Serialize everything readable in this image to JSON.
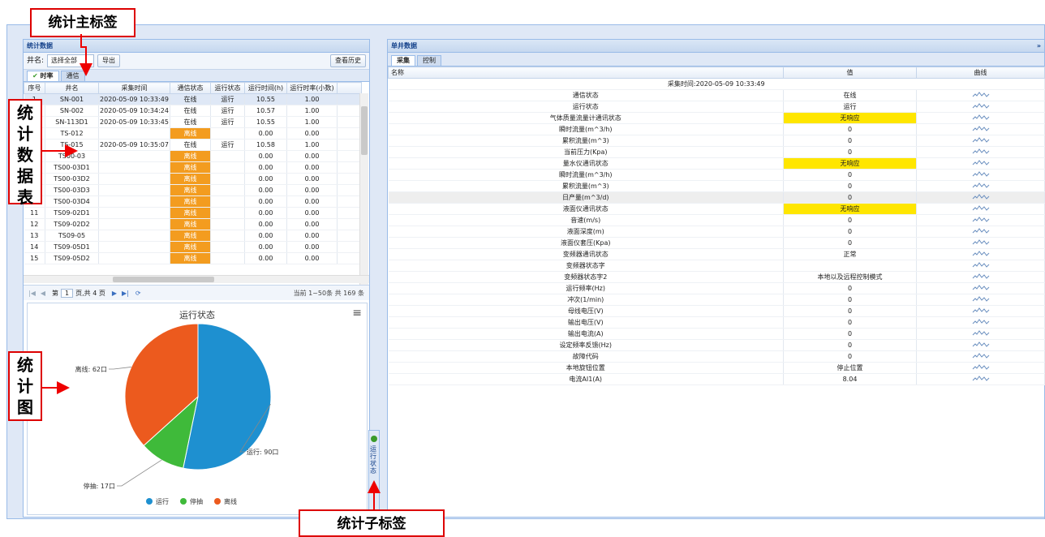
{
  "annotations": {
    "main_tab_label": "统计主标签",
    "table_label": "统计数据表",
    "chart_label": "统计图",
    "sub_tab_label": "统计子标签"
  },
  "left": {
    "panel_title": "统计数据",
    "well_label": "井名:",
    "well_select": "选择全部",
    "export_btn": "导出",
    "history_btn": "查看历史",
    "tabs": [
      "时率",
      "通信"
    ],
    "columns": [
      "序号",
      "井名",
      "采集时间",
      "通信状态",
      "运行状态",
      "运行时间(h)",
      "运行时率(小数)"
    ],
    "rows": [
      [
        "1",
        "SN-001",
        "2020-05-09 10:33:49",
        "在线",
        "运行",
        "10.55",
        "1.00"
      ],
      [
        "2",
        "SN-002",
        "2020-05-09 10:34:24",
        "在线",
        "运行",
        "10.57",
        "1.00"
      ],
      [
        "3",
        "SN-113D1",
        "2020-05-09 10:33:45",
        "在线",
        "运行",
        "10.55",
        "1.00"
      ],
      [
        "4",
        "TS-012",
        "",
        "离线",
        "",
        "0.00",
        "0.00"
      ],
      [
        "5",
        "TS-015",
        "2020-05-09 10:35:07",
        "在线",
        "运行",
        "10.58",
        "1.00"
      ],
      [
        "6",
        "TS00-03",
        "",
        "离线",
        "",
        "0.00",
        "0.00"
      ],
      [
        "7",
        "TS00-03D1",
        "",
        "离线",
        "",
        "0.00",
        "0.00"
      ],
      [
        "8",
        "TS00-03D2",
        "",
        "离线",
        "",
        "0.00",
        "0.00"
      ],
      [
        "9",
        "TS00-03D3",
        "",
        "离线",
        "",
        "0.00",
        "0.00"
      ],
      [
        "10",
        "TS00-03D4",
        "",
        "离线",
        "",
        "0.00",
        "0.00"
      ],
      [
        "11",
        "TS09-02D1",
        "",
        "离线",
        "",
        "0.00",
        "0.00"
      ],
      [
        "12",
        "TS09-02D2",
        "",
        "离线",
        "",
        "0.00",
        "0.00"
      ],
      [
        "13",
        "TS09-05",
        "",
        "离线",
        "",
        "0.00",
        "0.00"
      ],
      [
        "14",
        "TS09-05D1",
        "",
        "离线",
        "",
        "0.00",
        "0.00"
      ],
      [
        "15",
        "TS09-05D2",
        "",
        "离线",
        "",
        "0.00",
        "0.00"
      ]
    ],
    "pager": {
      "page_prefix": "第",
      "page": "1",
      "page_suffix": "页,共 4 页",
      "summary": "当前 1~50条 共 169 条"
    },
    "side_tab": "运行状态"
  },
  "chart_data": {
    "type": "pie",
    "title": "运行状态",
    "slices": [
      {
        "name": "运行",
        "value": 90,
        "color": "#1e90d0",
        "label": "运行: 90口"
      },
      {
        "name": "停抽",
        "value": 17,
        "color": "#3fba3a",
        "label": "停抽: 17口"
      },
      {
        "name": "离线",
        "value": 62,
        "color": "#ec5a1e",
        "label": "离线: 62口"
      }
    ],
    "legend_position": "bottom"
  },
  "right": {
    "panel_title": "单井数据",
    "tabs": [
      "采集",
      "控制"
    ],
    "columns": [
      "名称",
      "值",
      "曲线"
    ],
    "collect_time": "采集时间:2020-05-09 10:33:49",
    "rows": [
      [
        "通信状态",
        "在线",
        ""
      ],
      [
        "运行状态",
        "运行",
        ""
      ],
      [
        "气体质量流量计通讯状态",
        "无响应",
        "y"
      ],
      [
        "瞬时流量(m^3/h)",
        "0",
        ""
      ],
      [
        "累积流量(m^3)",
        "0",
        ""
      ],
      [
        "当前压力(Kpa)",
        "0",
        ""
      ],
      [
        "量水仪通讯状态",
        "无响应",
        "y"
      ],
      [
        "瞬时流量(m^3/h)",
        "0",
        ""
      ],
      [
        "累积流量(m^3)",
        "0",
        ""
      ],
      [
        "日产量(m^3/d)",
        "0",
        ""
      ],
      [
        "液面仪通讯状态",
        "无响应",
        "y"
      ],
      [
        "音速(m/s)",
        "0",
        ""
      ],
      [
        "液面深度(m)",
        "0",
        ""
      ],
      [
        "液面仪套压(Kpa)",
        "0",
        ""
      ],
      [
        "变频器通讯状态",
        "正常",
        ""
      ],
      [
        "变频器状态字",
        "",
        ""
      ],
      [
        "变频器状态字2",
        "本地以及远程控制模式",
        ""
      ],
      [
        "运行频率(Hz)",
        "0",
        ""
      ],
      [
        "冲次(1/min)",
        "0",
        ""
      ],
      [
        "母线电压(V)",
        "0",
        ""
      ],
      [
        "输出电压(V)",
        "0",
        ""
      ],
      [
        "输出电流(A)",
        "0",
        ""
      ],
      [
        "设定频率反馈(Hz)",
        "0",
        ""
      ],
      [
        "故障代码",
        "0",
        ""
      ],
      [
        "本地旋钮位置",
        "停止位置",
        ""
      ],
      [
        "电流AI1(A)",
        "8.04",
        ""
      ]
    ]
  }
}
